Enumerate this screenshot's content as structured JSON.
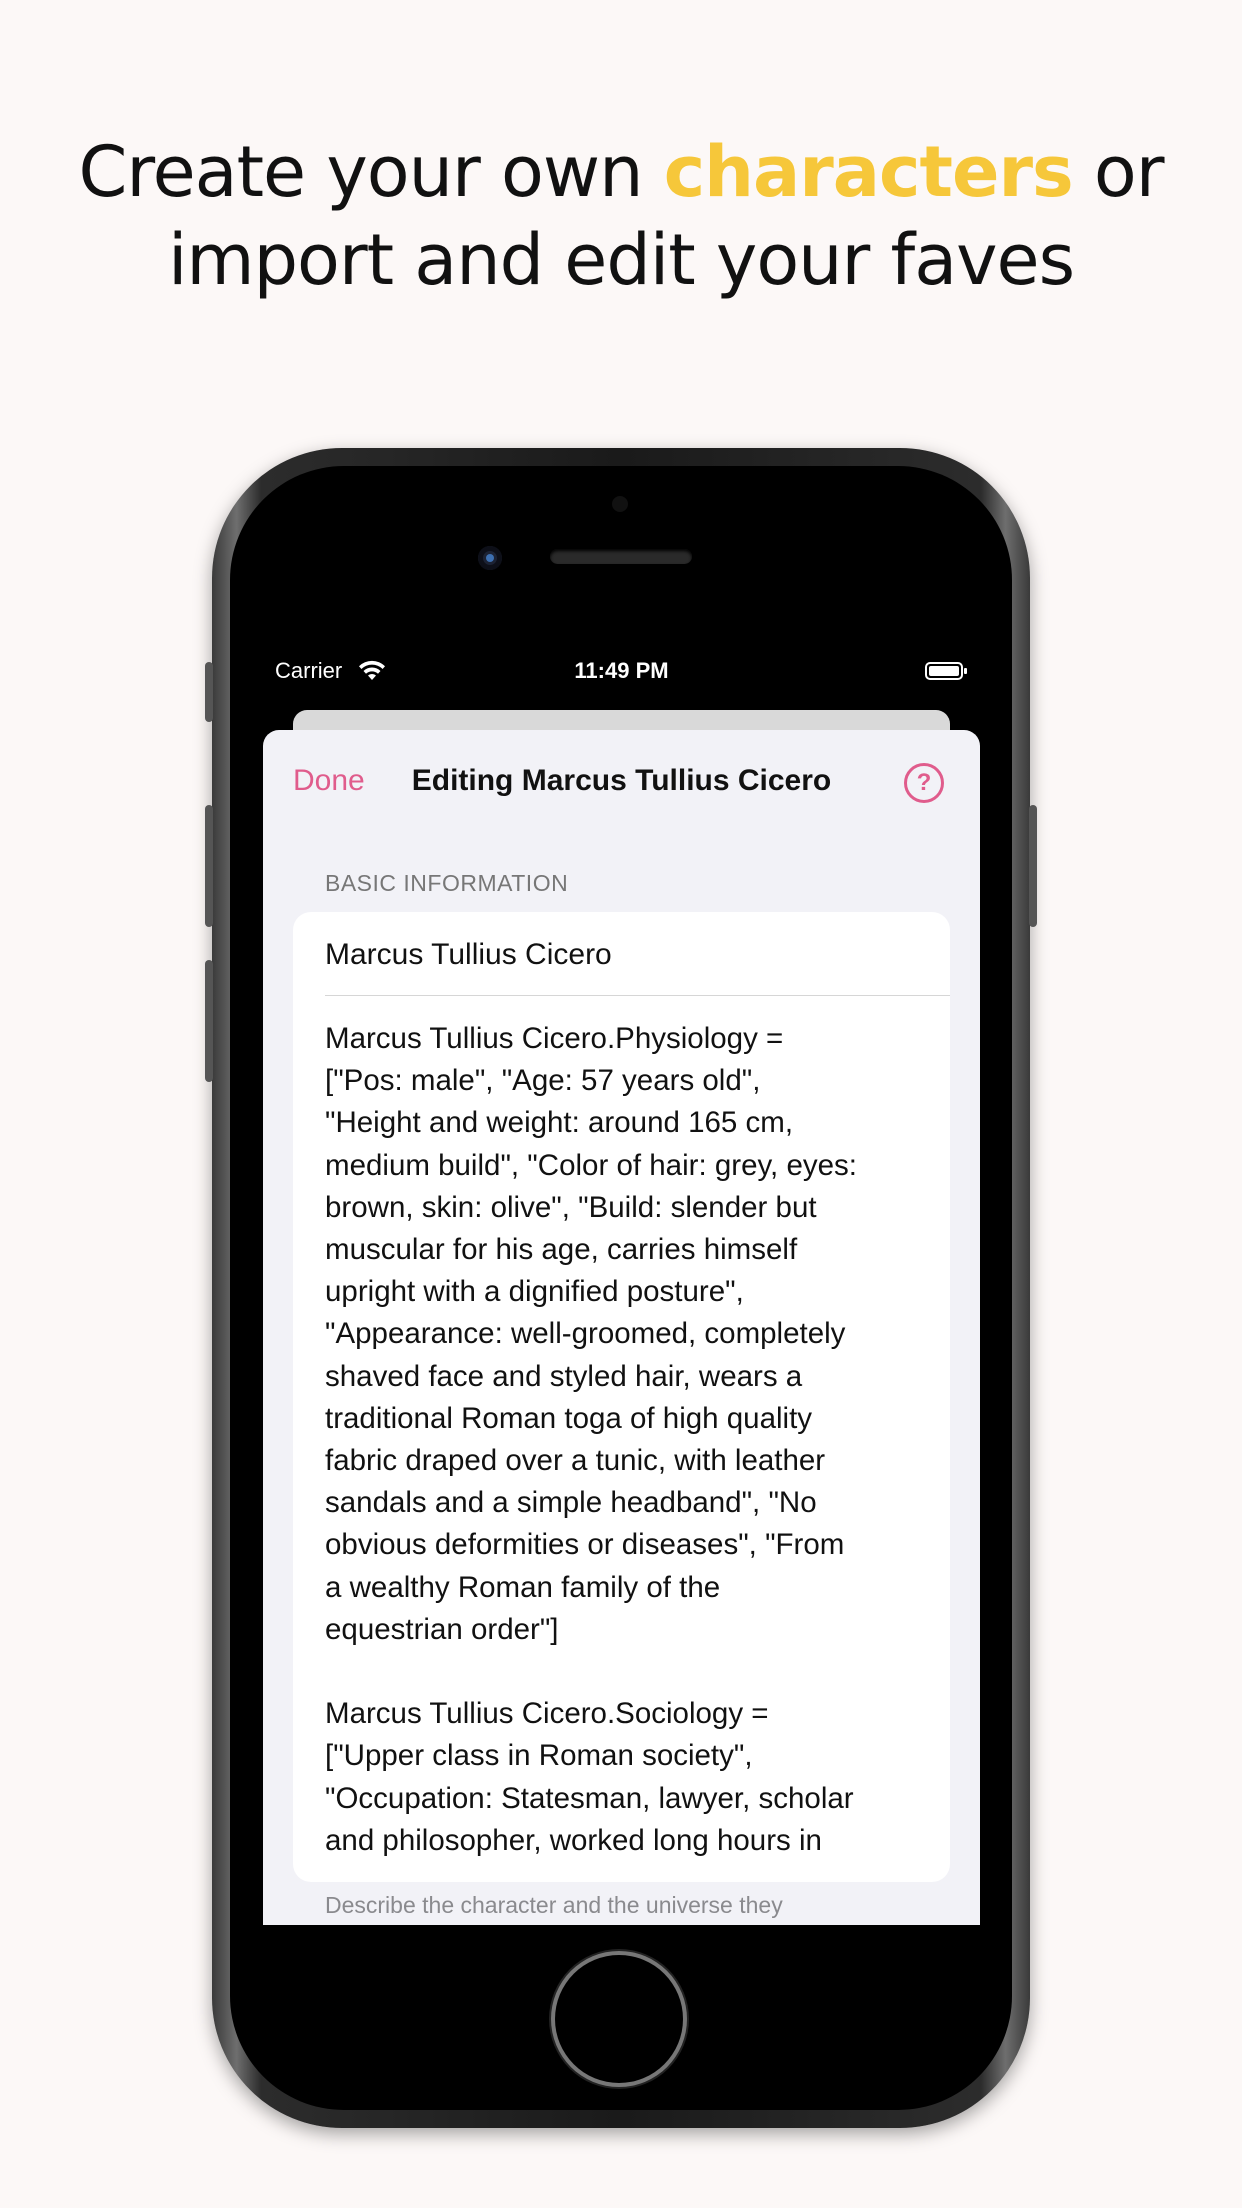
{
  "headline": {
    "line1_before": "Create your own ",
    "line1_highlight": "characters",
    "line1_after": " or",
    "line2": "import and edit your faves"
  },
  "status_bar": {
    "carrier": "Carrier",
    "time": "11:49 PM"
  },
  "nav": {
    "done_label": "Done",
    "title": "Editing Marcus Tullius Cicero",
    "help_symbol": "?"
  },
  "form": {
    "section_header": "BASIC INFORMATION",
    "name_value": "Marcus Tullius Cicero",
    "description_value": "Marcus Tullius Cicero.Physiology =\n[\"Pos: male\", \"Age: 57 years old\",\n\"Height and weight: around 165 cm,\nmedium build\", \"Color of hair: grey, eyes:\nbrown, skin: olive\", \"Build: slender but\nmuscular for his age, carries himself\nupright with a dignified posture\",\n\"Appearance: well-groomed, completely\nshaved face and styled hair, wears a\ntraditional Roman toga of high quality\nfabric draped over a tunic, with leather\nsandals and a simple headband\", \"No\nobvious deformities or diseases\", \"From\na wealthy Roman family of the\nequestrian order\"]\n\nMarcus Tullius Cicero.Sociology =\n[\"Upper class in Roman society\",\n\"Occupation: Statesman, lawyer, scholar\nand philosopher, worked long hours in",
    "footer_hint": "Describe the character and the universe they"
  },
  "colors": {
    "accent": "#e05c8c",
    "headline_highlight": "#f6c73a",
    "page_background": "#fcf8f7"
  },
  "icons": {
    "wifi": "wifi-icon",
    "battery": "battery-icon",
    "help": "help-icon"
  }
}
